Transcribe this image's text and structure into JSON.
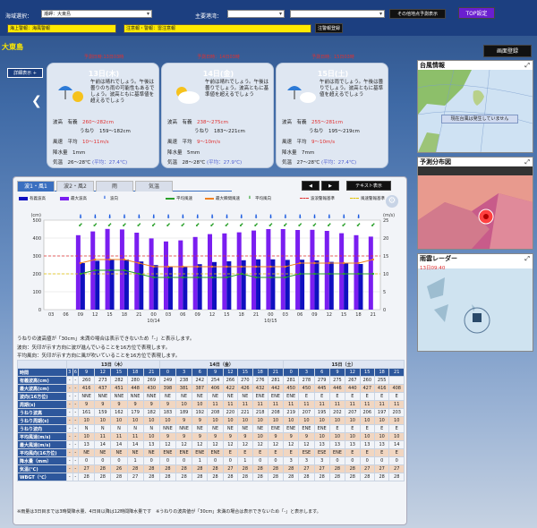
{
  "header": {
    "area_label": "海域選択：",
    "area_value": "潮岬：大東島",
    "major_port_label": "主要港湾：",
    "major_port_value": "",
    "other_port_value": "",
    "forecast_button": "その他地点予測表示",
    "top_button": "TOP設定",
    "warnings": [
      "海上警報：海風警報",
      "注意報・警報：雷注意報"
    ],
    "warnings_button": "注警報登録",
    "screen_button": "画面登録"
  },
  "place": "大東島",
  "detail_button": "詳細表示 +",
  "days": [
    {
      "label": "13日(木)",
      "date_note": "予測日時:13日03時",
      "desc": "午前は晴れでしょう。午後は曇りのち雨の可能性もあるでしょう。波高ともに基準値を超えるでしょう",
      "wave_title": "有義",
      "wave": "260〜282cm",
      "swell_title": "うねり",
      "swell": "159〜182cm",
      "wind_title": "平均",
      "wind": "10〜11m/s",
      "rain": "1mm",
      "temp": "26〜28℃",
      "temp_avg": "(平均：27.4℃)"
    },
    {
      "label": "14日(金)",
      "date_note": "予測日時：14日03時",
      "desc": "午前は晴れでしょう。午後は曇りでしょう。波高ともに基準値を超えるでしょう",
      "wave_title": "有義",
      "wave": "238〜275cm",
      "swell_title": "うねり",
      "swell": "183〜221cm",
      "wind_title": "平均",
      "wind": "9〜10m/s",
      "rain": "5mm",
      "temp": "28〜28℃",
      "temp_avg": "(平均：27.9℃)"
    },
    {
      "label": "15日(土)",
      "date_note": "予測日時：15日03時",
      "desc": "午前は雨でしょう。午後は曇りでしょう。波高ともに基準値を超えるでしょう",
      "wave_title": "有義",
      "wave": "255〜281cm",
      "swell_title": "うねり",
      "swell": "195〜219cm",
      "wind_title": "平均",
      "wind": "9〜10m/s",
      "rain": "7mm",
      "temp": "27〜28℃",
      "temp_avg": "(平均：27.4℃)"
    }
  ],
  "tabs": [
    "波1・風1",
    "波2・風2",
    "雨",
    "気温"
  ],
  "text_button": "テキスト表示",
  "prev_button": "◀",
  "next_button": "▶",
  "legend": [
    "有義波高",
    "最大波高",
    "波向",
    "平均風速",
    "最大瞬間風速",
    "平均風向",
    "波浪警報基準",
    "風速警報基準"
  ],
  "axis": {
    "left_unit": "(cm)",
    "right_unit": "(m/s)",
    "left_ticks": [
      "500",
      "400",
      "300",
      "200",
      "100",
      "0"
    ],
    "right_ticks": [
      "25",
      "20",
      "15",
      "10",
      "5",
      "0"
    ],
    "x_ticks": [
      "03",
      "06",
      "09",
      "12",
      "15",
      "18",
      "21",
      "00",
      "03",
      "06",
      "09",
      "12",
      "15",
      "18",
      "21",
      "00",
      "03",
      "06",
      "09",
      "12",
      "15",
      "18",
      "21"
    ],
    "x_dates": [
      "10/14",
      "10/15"
    ]
  },
  "chart_data": {
    "type": "bar",
    "ylim": [
      0,
      500
    ],
    "y2lim": [
      0,
      25
    ],
    "series": [
      {
        "name": "有義波高",
        "values": [
          null,
          null,
          260,
          273,
          282,
          280,
          269,
          249,
          238,
          242,
          254,
          266,
          270,
          276,
          281,
          281,
          278,
          279,
          275,
          267,
          260,
          255
        ]
      },
      {
        "name": "最大波高",
        "values": [
          null,
          null,
          416,
          437,
          451,
          448,
          430,
          398,
          381,
          387,
          406,
          422,
          426,
          432,
          442,
          450,
          450,
          445,
          446,
          440,
          427,
          416,
          408
        ]
      },
      {
        "name": "平均風速",
        "values": [
          null,
          null,
          10,
          11,
          11,
          11,
          10,
          9,
          9,
          9,
          9,
          9,
          9,
          10,
          9,
          9,
          9,
          10,
          10,
          10,
          10,
          10,
          10
        ]
      },
      {
        "name": "最大瞬間風速",
        "values": [
          null,
          null,
          13,
          14,
          14,
          14,
          13,
          12,
          12,
          12,
          12,
          12,
          12,
          12,
          12,
          12,
          12,
          13,
          13,
          13,
          13,
          13,
          14
        ]
      }
    ],
    "x": [
      "03",
      "06",
      "09",
      "12",
      "15",
      "18",
      "21",
      "00",
      "03",
      "06",
      "09",
      "12",
      "15",
      "18",
      "21",
      "00",
      "03",
      "06",
      "09",
      "12",
      "15",
      "18",
      "21"
    ],
    "thresholds": {
      "wave": 300,
      "wind": 10
    }
  },
  "notes": [
    "うねりの波高値が「30cm」未満の場合は表示できないため「-」と表示します。",
    "波向：矢印が示す方向に波が進んでいることを16方位で表現します。",
    "平均風向：矢印が示す方向に風が吹いていることを16方位で表現します。"
  ],
  "table": {
    "dates": [
      "13日（木）",
      "14日（金）",
      "15日（土）"
    ],
    "hours": [
      "3",
      "6",
      "9",
      "12",
      "15",
      "18",
      "21",
      "0",
      "3",
      "6",
      "9",
      "12",
      "15",
      "18",
      "21",
      "0",
      "3",
      "6",
      "9",
      "12",
      "15",
      "18",
      "21"
    ],
    "rows": [
      {
        "label": "時間",
        "cells": []
      },
      {
        "label": "有義波高(cm)",
        "cells": [
          "-",
          "-",
          "260",
          "273",
          "282",
          "280",
          "269",
          "249",
          "238",
          "242",
          "254",
          "266",
          "270",
          "276",
          "281",
          "281",
          "278",
          "279",
          "275",
          "267",
          "260",
          "255"
        ]
      },
      {
        "label": "最大波高(cm)",
        "cells": [
          "-",
          "-",
          "416",
          "437",
          "451",
          "448",
          "430",
          "398",
          "381",
          "387",
          "406",
          "422",
          "426",
          "432",
          "442",
          "450",
          "450",
          "445",
          "446",
          "440",
          "427",
          "416",
          "408"
        ]
      },
      {
        "label": "波向(16方位)",
        "cells": [
          "-",
          "-",
          "NNE",
          "NNE",
          "NNE",
          "NNE",
          "NNE",
          "NE",
          "NE",
          "NE",
          "NE",
          "NE",
          "NE",
          "ENE",
          "ENE",
          "ENE",
          "E",
          "E",
          "E",
          "E",
          "E",
          "E",
          "E"
        ]
      },
      {
        "label": "周期(s)",
        "cells": [
          "-",
          "-",
          "9",
          "9",
          "9",
          "9",
          "9",
          "9",
          "10",
          "10",
          "11",
          "11",
          "11",
          "11",
          "11",
          "11",
          "11",
          "11",
          "11",
          "11",
          "11",
          "11",
          "11"
        ]
      },
      {
        "label": "うねり波高",
        "cells": [
          "-",
          "-",
          "161",
          "159",
          "162",
          "179",
          "182",
          "183",
          "189",
          "192",
          "208",
          "220",
          "221",
          "218",
          "208",
          "219",
          "207",
          "195",
          "202",
          "207",
          "206",
          "197",
          "203"
        ]
      },
      {
        "label": "うねり周期(s)",
        "cells": [
          "-",
          "-",
          "10",
          "10",
          "10",
          "10",
          "10",
          "10",
          "9",
          "9",
          "10",
          "10",
          "10",
          "10",
          "10",
          "10",
          "10",
          "10",
          "10",
          "10",
          "10",
          "10",
          "10"
        ]
      },
      {
        "label": "うねり波向",
        "cells": [
          "-",
          "-",
          "N",
          "N",
          "N",
          "N",
          "N",
          "NNE",
          "NNE",
          "NE",
          "NE",
          "NE",
          "NE",
          "NE",
          "ENE",
          "ENE",
          "ENE",
          "ENE",
          "E",
          "E",
          "E",
          "E",
          "E"
        ]
      },
      {
        "label": "平均風速(m/s)",
        "cells": [
          "-",
          "-",
          "10",
          "11",
          "11",
          "11",
          "10",
          "9",
          "9",
          "9",
          "9",
          "9",
          "9",
          "10",
          "9",
          "9",
          "9",
          "10",
          "10",
          "10",
          "10",
          "10",
          "10"
        ]
      },
      {
        "label": "最大風速(m/s)",
        "cells": [
          "-",
          "-",
          "13",
          "14",
          "14",
          "14",
          "13",
          "12",
          "12",
          "12",
          "12",
          "12",
          "12",
          "12",
          "12",
          "12",
          "12",
          "13",
          "13",
          "13",
          "13",
          "13",
          "14"
        ]
      },
      {
        "label": "平均風向(16方位)",
        "cells": [
          "-",
          "-",
          "NE",
          "NE",
          "NE",
          "NE",
          "NE",
          "ENE",
          "ENE",
          "ENE",
          "ENE",
          "E",
          "E",
          "E",
          "E",
          "E",
          "ESE",
          "ESE",
          "ENE",
          "E",
          "E",
          "E",
          "E"
        ]
      },
      {
        "label": "降水量（mm）",
        "cells": [
          "-",
          "-",
          "0",
          "0",
          "0",
          "1",
          "0",
          "0",
          "0",
          "1",
          "0",
          "0",
          "1",
          "0",
          "0",
          "3",
          "3",
          "3",
          "0",
          "0",
          "0",
          "0",
          "0"
        ]
      },
      {
        "label": "気温(℃)",
        "cells": [
          "-",
          "-",
          "27",
          "28",
          "26",
          "28",
          "28",
          "28",
          "28",
          "28",
          "28",
          "27",
          "28",
          "28",
          "28",
          "28",
          "27",
          "27",
          "28",
          "28",
          "27",
          "27",
          "27"
        ]
      },
      {
        "label": "WBGT（℃）",
        "cells": [
          "-",
          "-",
          "28",
          "28",
          "28",
          "27",
          "28",
          "28",
          "28",
          "28",
          "28",
          "28",
          "28",
          "28",
          "28",
          "28",
          "28",
          "28",
          "28",
          "28",
          "28",
          "28",
          "28"
        ]
      }
    ]
  },
  "footnote": "※雨量は3日目までは3時間降水量、4日目以降は12時間降水量です　※うねりの波高値が「30cm」未満の場合は表示できないため「-」と表示します。",
  "side": {
    "typhoon_title": "台風情報",
    "typhoon_msg": "現在台風は発生していません",
    "dist_title": "予測分布図",
    "radar_title": "雨雲レーダー",
    "radar_time": "13日09:40"
  }
}
